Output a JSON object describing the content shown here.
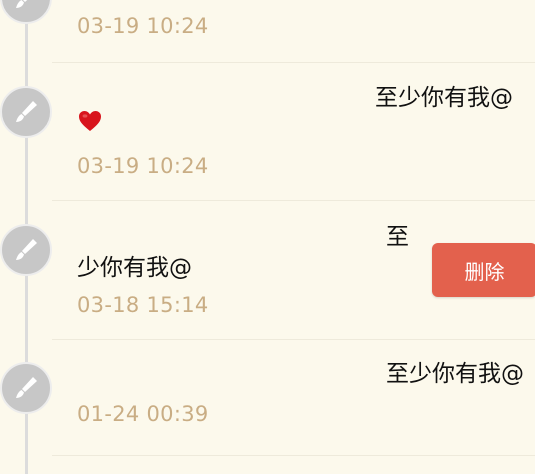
{
  "entries": [
    {
      "message": "",
      "timestamp": "03-19 10:24"
    },
    {
      "message": "至少你有我@",
      "emoji": "heart",
      "timestamp": "03-19 10:24"
    },
    {
      "message_start": "至",
      "message_rest": "少你有我@",
      "timestamp": "03-18 15:14",
      "action_label": "删除"
    },
    {
      "message": "至少你有我@",
      "timestamp": "01-24 00:39"
    }
  ],
  "colors": {
    "background": "#fcf9ec",
    "timestamp": "#c9ad84",
    "node": "#c7c7c7",
    "delete_button": "#e3614d"
  },
  "icons": {
    "node": "brush-icon",
    "emoji": "heart-icon"
  }
}
